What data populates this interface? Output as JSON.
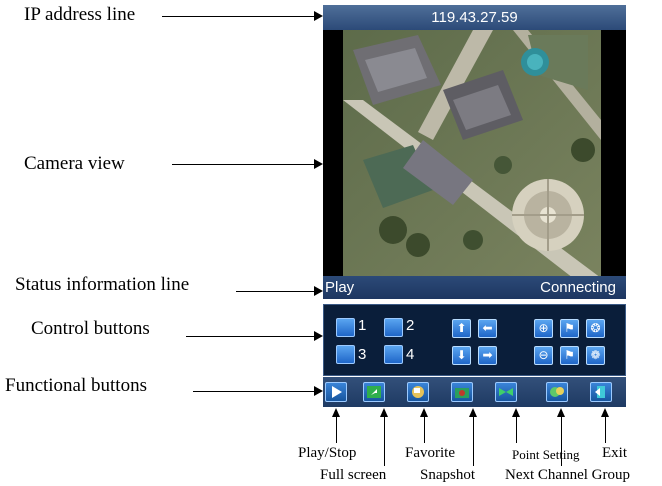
{
  "annotations": {
    "ip_address_line": "IP address line",
    "camera_view": "Camera view",
    "status_information_line": "Status information line",
    "control_buttons": "Control buttons",
    "functional_buttons": "Functional buttons"
  },
  "ip_bar": {
    "address": "119.43.27.59"
  },
  "status": {
    "mode": "Play",
    "state": "Connecting"
  },
  "channels": [
    "1",
    "2",
    "3",
    "4"
  ],
  "controls": {
    "ptz": [
      "arrow-up-icon",
      "arrow-left-icon",
      "arrow-down-icon",
      "arrow-right-icon"
    ],
    "zoom": [
      "zoom-in-icon",
      "focus-far-icon",
      "iris-open-icon",
      "zoom-out-icon",
      "focus-near-icon",
      "iris-close-icon"
    ]
  },
  "function_buttons": [
    {
      "icon": "play-icon",
      "label": "Play/Stop"
    },
    {
      "icon": "fullscreen-icon",
      "label": "Full screen"
    },
    {
      "icon": "favorite-icon",
      "label": "Favorite"
    },
    {
      "icon": "camera-icon",
      "label": "Snapshot"
    },
    {
      "icon": "point-setting-icon",
      "label": "Point Setting"
    },
    {
      "icon": "next-channel-icon",
      "label": "Next Channel Group"
    },
    {
      "icon": "exit-icon",
      "label": "Exit"
    }
  ],
  "colors": {
    "bar_blue": "#2c4a78",
    "panel_dark": "#0a1e3a",
    "button_blue": "#1f66c8"
  }
}
